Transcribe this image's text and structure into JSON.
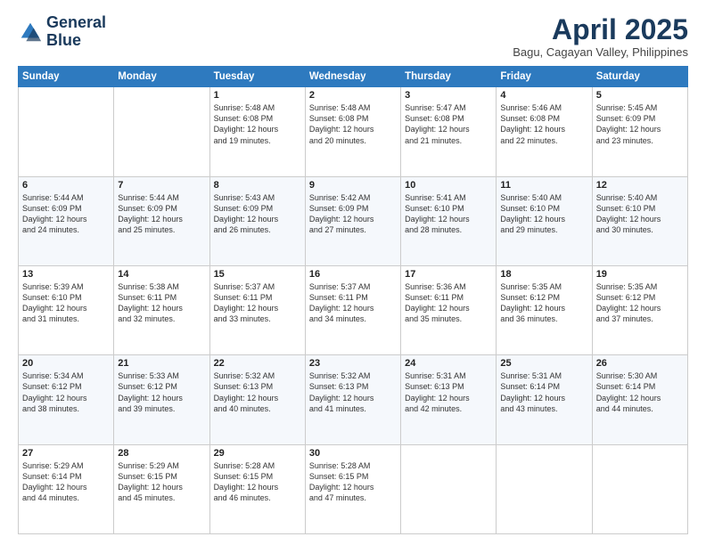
{
  "logo": {
    "line1": "General",
    "line2": "Blue"
  },
  "title": "April 2025",
  "location": "Bagu, Cagayan Valley, Philippines",
  "days_of_week": [
    "Sunday",
    "Monday",
    "Tuesday",
    "Wednesday",
    "Thursday",
    "Friday",
    "Saturday"
  ],
  "weeks": [
    [
      null,
      null,
      {
        "day": "1",
        "sunrise": "5:48 AM",
        "sunset": "6:08 PM",
        "daylight": "12 hours and 19 minutes."
      },
      {
        "day": "2",
        "sunrise": "5:48 AM",
        "sunset": "6:08 PM",
        "daylight": "12 hours and 20 minutes."
      },
      {
        "day": "3",
        "sunrise": "5:47 AM",
        "sunset": "6:08 PM",
        "daylight": "12 hours and 21 minutes."
      },
      {
        "day": "4",
        "sunrise": "5:46 AM",
        "sunset": "6:08 PM",
        "daylight": "12 hours and 22 minutes."
      },
      {
        "day": "5",
        "sunrise": "5:45 AM",
        "sunset": "6:09 PM",
        "daylight": "12 hours and 23 minutes."
      }
    ],
    [
      {
        "day": "6",
        "sunrise": "5:44 AM",
        "sunset": "6:09 PM",
        "daylight": "12 hours and 24 minutes."
      },
      {
        "day": "7",
        "sunrise": "5:44 AM",
        "sunset": "6:09 PM",
        "daylight": "12 hours and 25 minutes."
      },
      {
        "day": "8",
        "sunrise": "5:43 AM",
        "sunset": "6:09 PM",
        "daylight": "12 hours and 26 minutes."
      },
      {
        "day": "9",
        "sunrise": "5:42 AM",
        "sunset": "6:09 PM",
        "daylight": "12 hours and 27 minutes."
      },
      {
        "day": "10",
        "sunrise": "5:41 AM",
        "sunset": "6:10 PM",
        "daylight": "12 hours and 28 minutes."
      },
      {
        "day": "11",
        "sunrise": "5:40 AM",
        "sunset": "6:10 PM",
        "daylight": "12 hours and 29 minutes."
      },
      {
        "day": "12",
        "sunrise": "5:40 AM",
        "sunset": "6:10 PM",
        "daylight": "12 hours and 30 minutes."
      }
    ],
    [
      {
        "day": "13",
        "sunrise": "5:39 AM",
        "sunset": "6:10 PM",
        "daylight": "12 hours and 31 minutes."
      },
      {
        "day": "14",
        "sunrise": "5:38 AM",
        "sunset": "6:11 PM",
        "daylight": "12 hours and 32 minutes."
      },
      {
        "day": "15",
        "sunrise": "5:37 AM",
        "sunset": "6:11 PM",
        "daylight": "12 hours and 33 minutes."
      },
      {
        "day": "16",
        "sunrise": "5:37 AM",
        "sunset": "6:11 PM",
        "daylight": "12 hours and 34 minutes."
      },
      {
        "day": "17",
        "sunrise": "5:36 AM",
        "sunset": "6:11 PM",
        "daylight": "12 hours and 35 minutes."
      },
      {
        "day": "18",
        "sunrise": "5:35 AM",
        "sunset": "6:12 PM",
        "daylight": "12 hours and 36 minutes."
      },
      {
        "day": "19",
        "sunrise": "5:35 AM",
        "sunset": "6:12 PM",
        "daylight": "12 hours and 37 minutes."
      }
    ],
    [
      {
        "day": "20",
        "sunrise": "5:34 AM",
        "sunset": "6:12 PM",
        "daylight": "12 hours and 38 minutes."
      },
      {
        "day": "21",
        "sunrise": "5:33 AM",
        "sunset": "6:12 PM",
        "daylight": "12 hours and 39 minutes."
      },
      {
        "day": "22",
        "sunrise": "5:32 AM",
        "sunset": "6:13 PM",
        "daylight": "12 hours and 40 minutes."
      },
      {
        "day": "23",
        "sunrise": "5:32 AM",
        "sunset": "6:13 PM",
        "daylight": "12 hours and 41 minutes."
      },
      {
        "day": "24",
        "sunrise": "5:31 AM",
        "sunset": "6:13 PM",
        "daylight": "12 hours and 42 minutes."
      },
      {
        "day": "25",
        "sunrise": "5:31 AM",
        "sunset": "6:14 PM",
        "daylight": "12 hours and 43 minutes."
      },
      {
        "day": "26",
        "sunrise": "5:30 AM",
        "sunset": "6:14 PM",
        "daylight": "12 hours and 44 minutes."
      }
    ],
    [
      {
        "day": "27",
        "sunrise": "5:29 AM",
        "sunset": "6:14 PM",
        "daylight": "12 hours and 44 minutes."
      },
      {
        "day": "28",
        "sunrise": "5:29 AM",
        "sunset": "6:15 PM",
        "daylight": "12 hours and 45 minutes."
      },
      {
        "day": "29",
        "sunrise": "5:28 AM",
        "sunset": "6:15 PM",
        "daylight": "12 hours and 46 minutes."
      },
      {
        "day": "30",
        "sunrise": "5:28 AM",
        "sunset": "6:15 PM",
        "daylight": "12 hours and 47 minutes."
      },
      null,
      null,
      null
    ]
  ]
}
